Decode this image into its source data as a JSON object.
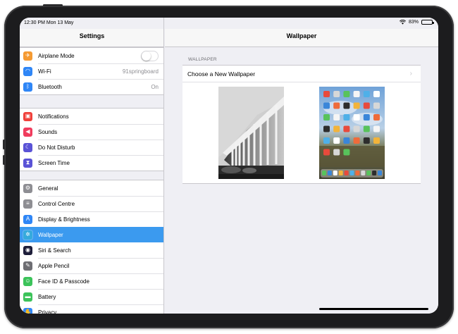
{
  "status_bar": {
    "time": "12:30 PM  Mon 13 May",
    "battery": "83%",
    "battery_level": 0.83
  },
  "sidebar": {
    "title": "Settings",
    "groups": [
      [
        {
          "label": "Airplane Mode",
          "icon": "airplane-icon",
          "color": "#f59a32",
          "accessory": "toggle",
          "on": false
        },
        {
          "label": "Wi-Fi",
          "icon": "wifi-icon",
          "color": "#2f86f6",
          "value": "91springboard"
        },
        {
          "label": "Bluetooth",
          "icon": "bluetooth-icon",
          "color": "#2f86f6",
          "value": "On"
        }
      ],
      [
        {
          "label": "Notifications",
          "icon": "notifications-icon",
          "color": "#f0413b"
        },
        {
          "label": "Sounds",
          "icon": "speaker-icon",
          "color": "#f03c5d"
        },
        {
          "label": "Do Not Disturb",
          "icon": "moon-icon",
          "color": "#5a53d6"
        },
        {
          "label": "Screen Time",
          "icon": "hourglass-icon",
          "color": "#5a53d6"
        }
      ],
      [
        {
          "label": "General",
          "icon": "gear-icon",
          "color": "#8e8e93"
        },
        {
          "label": "Control Centre",
          "icon": "switches-icon",
          "color": "#8e8e93"
        },
        {
          "label": "Display & Brightness",
          "icon": "text-size-icon",
          "color": "#2f86f6"
        },
        {
          "label": "Wallpaper",
          "icon": "flower-icon",
          "color": "#35aadc",
          "selected": true
        },
        {
          "label": "Siri & Search",
          "icon": "siri-icon",
          "color": "#1e1e3a"
        },
        {
          "label": "Apple Pencil",
          "icon": "pencil-icon",
          "color": "#6e6e73"
        },
        {
          "label": "Face ID & Passcode",
          "icon": "face-id-icon",
          "color": "#3cc35a"
        },
        {
          "label": "Battery",
          "icon": "battery-icon",
          "color": "#3cc35a"
        },
        {
          "label": "Privacy",
          "icon": "hand-icon",
          "color": "#2f86f6"
        }
      ]
    ]
  },
  "detail": {
    "title": "Wallpaper",
    "section_label": "WALLPAPER",
    "choose_label": "Choose a New Wallpaper",
    "chevron": "›"
  },
  "icon_glyphs": {
    "airplane-icon": "✈",
    "wifi-icon": "◠",
    "bluetooth-icon": "ᛒ",
    "notifications-icon": "▣",
    "speaker-icon": "◀",
    "moon-icon": "☾",
    "hourglass-icon": "⧗",
    "gear-icon": "⚙",
    "switches-icon": "≡",
    "text-size-icon": "A",
    "flower-icon": "✲",
    "siri-icon": "◉",
    "pencil-icon": "✎",
    "face-id-icon": "☺",
    "battery-icon": "▬",
    "hand-icon": "✋"
  }
}
